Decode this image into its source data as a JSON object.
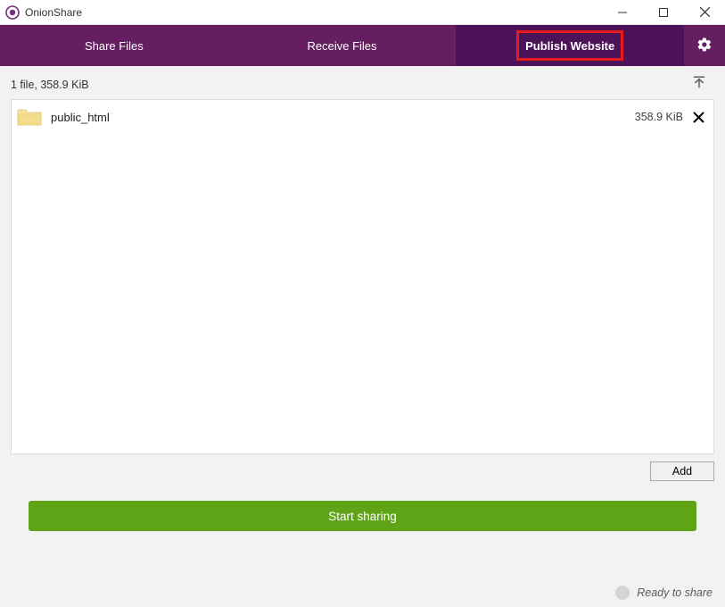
{
  "window": {
    "title": "OnionShare"
  },
  "tabs": {
    "share": "Share Files",
    "receive": "Receive Files",
    "publish": "Publish Website"
  },
  "summary": "1 file, 358.9 KiB",
  "files": [
    {
      "name": "public_html",
      "size": "358.9 KiB"
    }
  ],
  "buttons": {
    "add": "Add",
    "start": "Start sharing"
  },
  "status": {
    "text": "Ready to share"
  }
}
